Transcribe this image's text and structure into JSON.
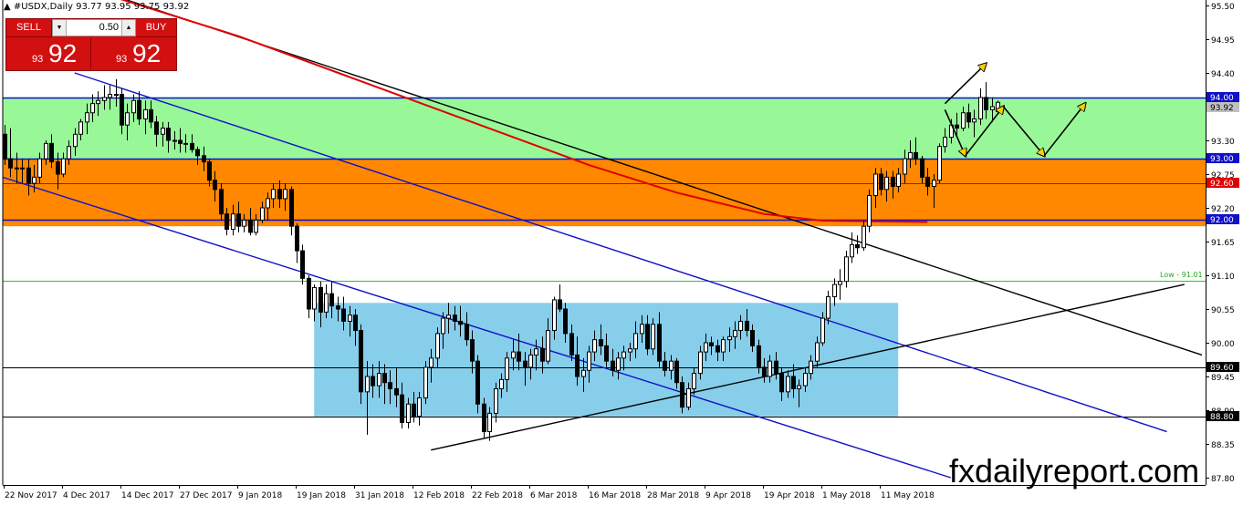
{
  "header": {
    "text": "#USDX,Daily  93.77 93.95 93.75 93.92"
  },
  "trade_panel": {
    "sell_label": "SELL",
    "buy_label": "BUY",
    "lot": "0.50",
    "sell_small": "93",
    "sell_big": "92",
    "buy_small": "93",
    "buy_big": "92"
  },
  "watermark": "fxdailyreport.com",
  "chart_data": {
    "type": "candlestick",
    "symbol": "#USDX",
    "timeframe": "Daily",
    "ylim": [
      87.8,
      95.5
    ],
    "y_ticks": [
      95.5,
      94.95,
      94.4,
      93.85,
      93.3,
      92.75,
      92.2,
      91.65,
      91.1,
      90.55,
      90.0,
      89.45,
      88.9,
      88.35,
      87.8
    ],
    "x_ticks": [
      "22 Nov 2017",
      "4 Dec 2017",
      "14 Dec 2017",
      "27 Dec 2017",
      "9 Jan 2018",
      "19 Jan 2018",
      "31 Jan 2018",
      "12 Feb 2018",
      "22 Feb 2018",
      "6 Mar 2018",
      "16 Mar 2018",
      "28 Mar 2018",
      "9 Apr 2018",
      "19 Apr 2018",
      "1 May 2018",
      "11 May 2018"
    ],
    "price_labels": [
      {
        "text": "94.00",
        "value": 94.0,
        "color": "#1010c8"
      },
      {
        "text": "93.92",
        "value": 93.92,
        "color": "#c0c0c0"
      },
      {
        "text": "93.00",
        "value": 93.0,
        "color": "#1010c8"
      },
      {
        "text": "92.60",
        "value": 92.6,
        "color": "#e00000"
      },
      {
        "text": "92.00",
        "value": 92.0,
        "color": "#1010c8"
      },
      {
        "text": "89.60",
        "value": 89.6,
        "color": "#000000"
      },
      {
        "text": "88.80",
        "value": 88.8,
        "color": "#000000"
      }
    ],
    "low_label": "Low - 91.01",
    "zones": [
      {
        "from": 93.0,
        "to": 94.0,
        "color": "#98f898"
      },
      {
        "from": 91.9,
        "to": 93.0,
        "color": "#ff8800"
      }
    ],
    "rect_zone": {
      "x_from": 53,
      "x_to": 153,
      "y_from": 88.8,
      "y_to": 90.65,
      "color": "#87ceeb"
    },
    "hlines": [
      {
        "value": 94.0,
        "color": "#1010c8"
      },
      {
        "value": 93.0,
        "color": "#1010c8"
      },
      {
        "value": 92.6,
        "color": "#e00000"
      },
      {
        "value": 92.0,
        "color": "#1010c8"
      },
      {
        "value": 91.01,
        "color": "#22cc22"
      },
      {
        "value": 89.6,
        "color": "#000000"
      },
      {
        "value": 88.8,
        "color": "#000000"
      }
    ],
    "trendlines": [
      {
        "x1": -8,
        "y1": 96.5,
        "x2": 205,
        "y2": 89.8,
        "color": "#000000"
      },
      {
        "x1": 12,
        "y1": 94.4,
        "x2": 199,
        "y2": 88.55,
        "color": "#1010c8"
      },
      {
        "x1": -2,
        "y1": 92.75,
        "x2": 162,
        "y2": 87.8,
        "color": "#1010c8"
      },
      {
        "x1": 73,
        "y1": 88.25,
        "x2": 202,
        "y2": 90.95,
        "color": "#000000"
      }
    ],
    "ma": {
      "color": "#e00000",
      "points": [
        [
          -2,
          96.1
        ],
        [
          20,
          95.6
        ],
        [
          40,
          95.0
        ],
        [
          60,
          94.3
        ],
        [
          80,
          93.6
        ],
        [
          100,
          92.9
        ],
        [
          115,
          92.45
        ],
        [
          130,
          92.1
        ],
        [
          140,
          91.99
        ],
        [
          158,
          91.97
        ]
      ]
    },
    "arrows": [
      {
        "x1": 161,
        "y1": 93.9,
        "x2": 168,
        "y2": 94.55,
        "color": "#000000"
      },
      {
        "x1": 161,
        "y1": 93.8,
        "x2": 164.5,
        "y2": 93.05,
        "color": "#000000"
      },
      {
        "x1": 164.5,
        "y1": 93.05,
        "x2": 171,
        "y2": 93.85,
        "color": "#000000"
      },
      {
        "x1": 171,
        "y1": 93.85,
        "x2": 178,
        "y2": 93.05,
        "color": "#000000"
      },
      {
        "x1": 178,
        "y1": 93.05,
        "x2": 185,
        "y2": 93.9,
        "color": "#000000"
      }
    ],
    "ohlc": [
      [
        93.4,
        93.55,
        92.9,
        93.0
      ],
      [
        93.0,
        93.5,
        92.7,
        92.85
      ],
      [
        92.85,
        93.1,
        92.6,
        92.85
      ],
      [
        92.85,
        93.0,
        92.6,
        92.85
      ],
      [
        92.85,
        93.0,
        92.4,
        92.6
      ],
      [
        92.6,
        92.9,
        92.45,
        92.7
      ],
      [
        92.7,
        93.1,
        92.6,
        93.0
      ],
      [
        93.0,
        93.3,
        92.9,
        93.25
      ],
      [
        93.25,
        93.4,
        92.85,
        92.95
      ],
      [
        92.95,
        93.1,
        92.5,
        92.75
      ],
      [
        92.75,
        93.1,
        92.7,
        93.0
      ],
      [
        93.0,
        93.3,
        92.9,
        93.2
      ],
      [
        93.2,
        93.5,
        93.05,
        93.4
      ],
      [
        93.4,
        93.65,
        93.3,
        93.6
      ],
      [
        93.6,
        93.9,
        93.4,
        93.75
      ],
      [
        93.75,
        94.05,
        93.6,
        93.9
      ],
      [
        93.9,
        94.1,
        93.7,
        93.95
      ],
      [
        93.95,
        94.2,
        93.8,
        94.0
      ],
      [
        94.0,
        94.2,
        93.8,
        94.05
      ],
      [
        94.05,
        94.3,
        93.85,
        94.05
      ],
      [
        94.05,
        94.15,
        93.4,
        93.55
      ],
      [
        93.55,
        93.9,
        93.3,
        93.75
      ],
      [
        93.75,
        94.05,
        93.6,
        93.95
      ],
      [
        93.95,
        94.1,
        93.55,
        93.65
      ],
      [
        93.65,
        93.95,
        93.4,
        93.8
      ],
      [
        93.8,
        93.95,
        93.5,
        93.6
      ],
      [
        93.6,
        93.7,
        93.2,
        93.4
      ],
      [
        93.4,
        93.6,
        93.2,
        93.5
      ],
      [
        93.5,
        93.6,
        93.1,
        93.3
      ],
      [
        93.3,
        93.45,
        93.15,
        93.3
      ],
      [
        93.3,
        93.5,
        93.1,
        93.25
      ],
      [
        93.25,
        93.4,
        93.1,
        93.25
      ],
      [
        93.25,
        93.4,
        93.1,
        93.15
      ],
      [
        93.15,
        93.2,
        92.9,
        93.05
      ],
      [
        93.05,
        93.2,
        92.8,
        92.95
      ],
      [
        92.95,
        93.0,
        92.55,
        92.65
      ],
      [
        92.65,
        92.8,
        92.3,
        92.5
      ],
      [
        92.5,
        92.6,
        92.0,
        92.1
      ],
      [
        92.1,
        92.2,
        91.75,
        91.85
      ],
      [
        91.85,
        92.25,
        91.75,
        92.1
      ],
      [
        92.1,
        92.3,
        91.8,
        91.9
      ],
      [
        91.9,
        92.1,
        91.8,
        92.0
      ],
      [
        92.0,
        92.2,
        91.75,
        91.8
      ],
      [
        91.8,
        92.1,
        91.75,
        92.0
      ],
      [
        92.0,
        92.3,
        91.95,
        92.2
      ],
      [
        92.2,
        92.45,
        92.0,
        92.35
      ],
      [
        92.35,
        92.6,
        92.2,
        92.5
      ],
      [
        92.5,
        92.65,
        92.2,
        92.35
      ],
      [
        92.35,
        92.6,
        92.15,
        92.5
      ],
      [
        92.5,
        92.55,
        91.75,
        91.9
      ],
      [
        91.9,
        91.95,
        91.3,
        91.5
      ],
      [
        91.5,
        91.6,
        90.95,
        91.05
      ],
      [
        91.05,
        91.1,
        90.4,
        90.55
      ],
      [
        90.55,
        90.95,
        90.35,
        90.9
      ],
      [
        90.9,
        91.0,
        90.25,
        90.5
      ],
      [
        90.5,
        90.95,
        90.4,
        90.8
      ],
      [
        90.8,
        91.0,
        90.4,
        90.6
      ],
      [
        90.6,
        90.75,
        90.35,
        90.55
      ],
      [
        90.55,
        90.75,
        90.2,
        90.35
      ],
      [
        90.35,
        90.6,
        90.1,
        90.45
      ],
      [
        90.45,
        90.55,
        89.95,
        90.2
      ],
      [
        90.2,
        90.3,
        89.0,
        89.2
      ],
      [
        89.2,
        89.7,
        88.5,
        89.45
      ],
      [
        89.45,
        89.65,
        89.1,
        89.3
      ],
      [
        89.3,
        89.7,
        89.1,
        89.5
      ],
      [
        89.5,
        89.65,
        89.0,
        89.35
      ],
      [
        89.35,
        89.55,
        89.0,
        89.25
      ],
      [
        89.25,
        89.6,
        88.95,
        89.15
      ],
      [
        89.15,
        89.35,
        88.6,
        88.7
      ],
      [
        88.7,
        89.1,
        88.6,
        89.0
      ],
      [
        89.0,
        89.2,
        88.7,
        88.8
      ],
      [
        88.8,
        89.2,
        88.65,
        89.1
      ],
      [
        89.1,
        89.7,
        89.0,
        89.6
      ],
      [
        89.6,
        89.9,
        89.35,
        89.75
      ],
      [
        89.75,
        90.25,
        89.6,
        90.15
      ],
      [
        90.15,
        90.5,
        89.9,
        90.4
      ],
      [
        90.4,
        90.65,
        90.15,
        90.45
      ],
      [
        90.45,
        90.6,
        90.2,
        90.35
      ],
      [
        90.35,
        90.6,
        90.1,
        90.3
      ],
      [
        90.3,
        90.5,
        89.95,
        90.05
      ],
      [
        90.05,
        90.2,
        89.5,
        89.7
      ],
      [
        89.7,
        89.8,
        88.85,
        89.0
      ],
      [
        89.0,
        89.1,
        88.45,
        88.55
      ],
      [
        88.55,
        88.95,
        88.4,
        88.85
      ],
      [
        88.85,
        89.35,
        88.7,
        89.25
      ],
      [
        89.25,
        89.5,
        89.1,
        89.4
      ],
      [
        89.4,
        89.85,
        89.2,
        89.75
      ],
      [
        89.75,
        90.05,
        89.55,
        89.85
      ],
      [
        89.85,
        90.15,
        89.55,
        89.7
      ],
      [
        89.7,
        89.85,
        89.3,
        89.6
      ],
      [
        89.6,
        89.9,
        89.4,
        89.8
      ],
      [
        89.8,
        90.05,
        89.55,
        89.9
      ],
      [
        89.9,
        90.1,
        89.5,
        89.7
      ],
      [
        89.7,
        90.4,
        89.65,
        90.2
      ],
      [
        90.2,
        90.75,
        90.05,
        90.7
      ],
      [
        90.7,
        90.95,
        90.5,
        90.55
      ],
      [
        90.55,
        90.65,
        90.0,
        90.15
      ],
      [
        90.15,
        90.3,
        89.7,
        89.8
      ],
      [
        89.8,
        90.1,
        89.3,
        89.45
      ],
      [
        89.45,
        89.75,
        89.2,
        89.55
      ],
      [
        89.55,
        89.95,
        89.35,
        89.85
      ],
      [
        89.85,
        90.2,
        89.7,
        90.05
      ],
      [
        90.05,
        90.3,
        89.8,
        89.95
      ],
      [
        89.95,
        90.15,
        89.6,
        89.7
      ],
      [
        89.7,
        89.9,
        89.45,
        89.55
      ],
      [
        89.55,
        89.85,
        89.4,
        89.75
      ],
      [
        89.75,
        89.95,
        89.55,
        89.85
      ],
      [
        89.85,
        90.0,
        89.7,
        89.9
      ],
      [
        89.9,
        90.35,
        89.75,
        90.15
      ],
      [
        90.15,
        90.45,
        90.0,
        90.3
      ],
      [
        90.3,
        90.45,
        89.8,
        89.9
      ],
      [
        89.9,
        90.4,
        89.8,
        90.3
      ],
      [
        90.3,
        90.5,
        89.6,
        89.7
      ],
      [
        89.7,
        89.85,
        89.45,
        89.55
      ],
      [
        89.55,
        89.8,
        89.4,
        89.7
      ],
      [
        89.7,
        89.75,
        89.25,
        89.35
      ],
      [
        89.35,
        89.45,
        88.85,
        88.95
      ],
      [
        88.95,
        89.35,
        88.9,
        89.25
      ],
      [
        89.25,
        89.6,
        89.15,
        89.5
      ],
      [
        89.5,
        89.95,
        89.4,
        89.85
      ],
      [
        89.85,
        90.15,
        89.7,
        90.0
      ],
      [
        90.0,
        90.1,
        89.8,
        89.95
      ],
      [
        89.95,
        90.05,
        89.7,
        89.85
      ],
      [
        89.85,
        90.1,
        89.7,
        90.05
      ],
      [
        90.05,
        90.25,
        89.85,
        90.1
      ],
      [
        90.1,
        90.35,
        89.9,
        90.2
      ],
      [
        90.2,
        90.45,
        90.05,
        90.35
      ],
      [
        90.35,
        90.55,
        90.1,
        90.2
      ],
      [
        90.2,
        90.3,
        89.85,
        89.95
      ],
      [
        89.95,
        90.05,
        89.5,
        89.6
      ],
      [
        89.6,
        89.75,
        89.35,
        89.45
      ],
      [
        89.45,
        89.8,
        89.35,
        89.7
      ],
      [
        89.7,
        89.85,
        89.4,
        89.5
      ],
      [
        89.5,
        89.6,
        89.05,
        89.2
      ],
      [
        89.2,
        89.55,
        89.1,
        89.45
      ],
      [
        89.45,
        89.65,
        89.1,
        89.25
      ],
      [
        89.25,
        89.4,
        88.95,
        89.3
      ],
      [
        89.3,
        89.6,
        89.2,
        89.5
      ],
      [
        89.5,
        89.8,
        89.4,
        89.7
      ],
      [
        89.7,
        90.1,
        89.6,
        90.0
      ],
      [
        90.0,
        90.5,
        89.95,
        90.4
      ],
      [
        90.4,
        90.85,
        90.3,
        90.75
      ],
      [
        90.75,
        91.05,
        90.6,
        90.95
      ],
      [
        90.95,
        91.2,
        90.7,
        91.0
      ],
      [
        91.0,
        91.5,
        90.9,
        91.4
      ],
      [
        91.4,
        91.8,
        91.3,
        91.6
      ],
      [
        91.6,
        91.75,
        91.45,
        91.55
      ],
      [
        91.55,
        92.0,
        91.5,
        91.9
      ],
      [
        91.9,
        92.5,
        91.8,
        92.4
      ],
      [
        92.4,
        92.85,
        92.2,
        92.75
      ],
      [
        92.75,
        92.85,
        92.4,
        92.5
      ],
      [
        92.5,
        92.8,
        92.3,
        92.7
      ],
      [
        92.7,
        92.8,
        92.35,
        92.55
      ],
      [
        92.55,
        92.85,
        92.45,
        92.75
      ],
      [
        92.75,
        93.15,
        92.6,
        93.0
      ],
      [
        93.0,
        93.3,
        92.85,
        93.1
      ],
      [
        93.1,
        93.35,
        92.9,
        93.0
      ],
      [
        93.0,
        93.05,
        92.6,
        92.7
      ],
      [
        92.7,
        92.85,
        92.4,
        92.55
      ],
      [
        92.55,
        92.75,
        92.2,
        92.65
      ],
      [
        92.65,
        93.25,
        92.6,
        93.2
      ],
      [
        93.2,
        93.5,
        93.1,
        93.35
      ],
      [
        93.35,
        93.65,
        93.25,
        93.55
      ],
      [
        93.55,
        93.75,
        93.35,
        93.5
      ],
      [
        93.5,
        93.85,
        93.45,
        93.75
      ],
      [
        93.75,
        93.9,
        93.5,
        93.6
      ],
      [
        93.6,
        93.8,
        93.35,
        93.65
      ],
      [
        93.65,
        94.15,
        93.55,
        94.0
      ],
      [
        94.0,
        94.25,
        93.65,
        93.8
      ],
      [
        93.8,
        94.0,
        93.6,
        93.85
      ],
      [
        93.77,
        93.95,
        93.75,
        93.92
      ]
    ]
  }
}
